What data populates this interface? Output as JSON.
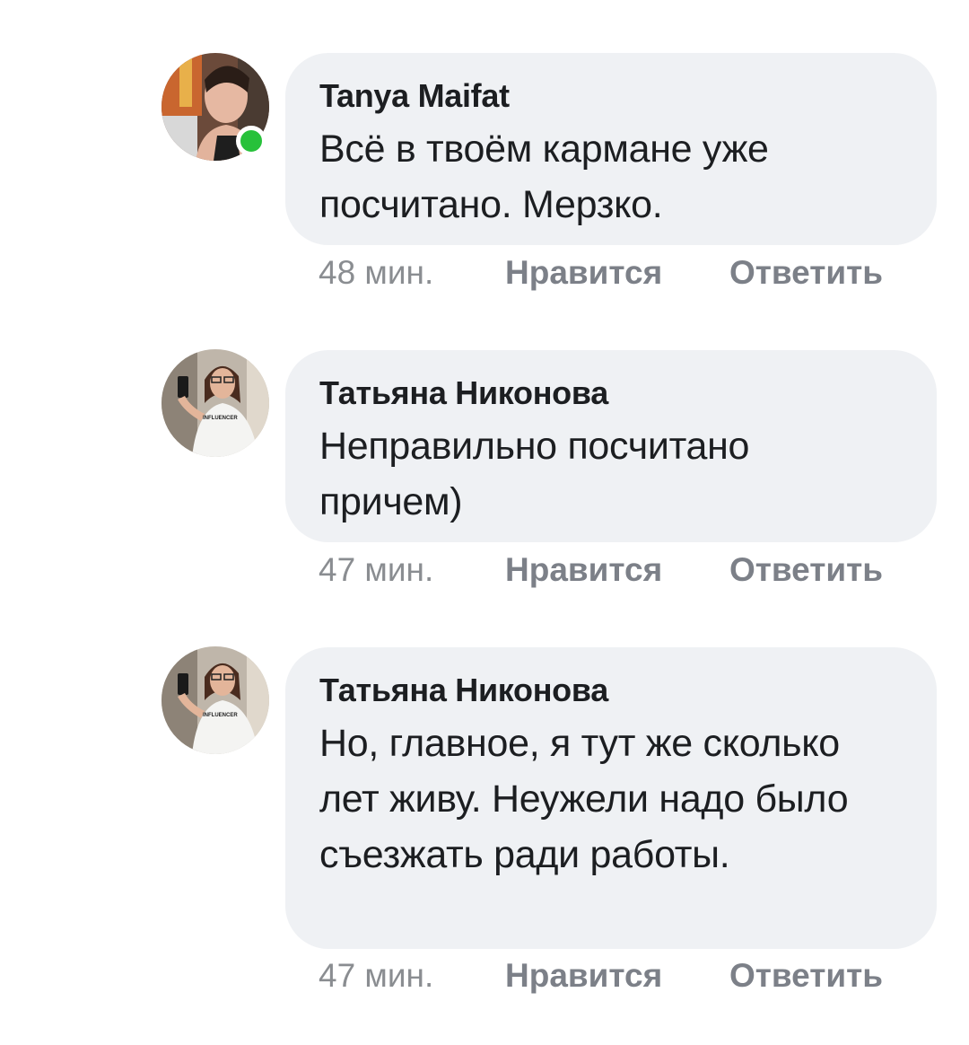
{
  "comments": [
    {
      "author": "Tanya Maifat",
      "text": "Всё в твоём кармане уже посчитано. Мерзко.",
      "time": "48 мин.",
      "like_label": "Нравится",
      "reply_label": "Ответить",
      "online": true
    },
    {
      "author": "Татьяна Никонова",
      "text": "Неправильно посчитано причем)",
      "time": "47 мин.",
      "like_label": "Нравится",
      "reply_label": "Ответить",
      "online": false
    },
    {
      "author": "Татьяна Никонова",
      "text": "Но, главное, я тут же сколько лет живу. Неужели надо было съезжать ради работы.",
      "time": "47 мин.",
      "like_label": "Нравится",
      "reply_label": "Ответить",
      "online": false
    }
  ],
  "avatar_shirt_text": "INFLUENCER",
  "colors": {
    "bubble": "#eff1f4",
    "online": "#27c13a",
    "meta": "#8a8d91",
    "text": "#1c1e21"
  }
}
